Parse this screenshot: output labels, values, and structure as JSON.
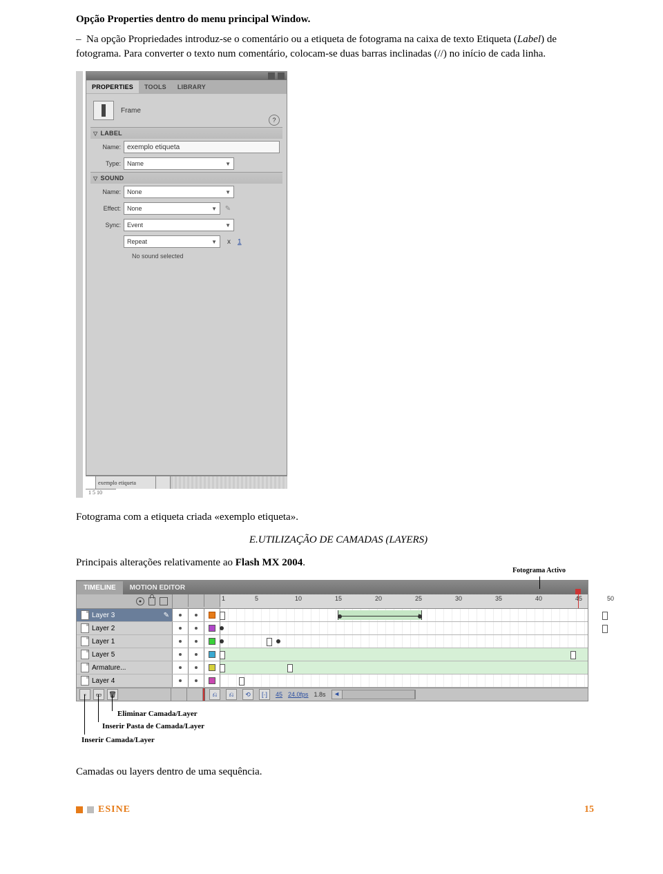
{
  "title": "Opção Properties dentro do menu principal Window.",
  "para1_a": "Na opção Propriedades introduz-se o comentário ou a etiqueta de fotograma na caixa de texto Etiqueta (",
  "para1_it": "Label",
  "para1_b": ") de fotograma. Para converter o texto num comentário, colocam-se duas barras inclinadas (//) no início de cada linha.",
  "props": {
    "tabs": {
      "properties": "PROPERTIES",
      "tools": "TOOLS",
      "library": "LIBRARY"
    },
    "frame": "Frame",
    "label_section": "LABEL",
    "name_label": "Name:",
    "name_value": "exemplo etiqueta",
    "type_label": "Type:",
    "type_value": "Name",
    "sound_section": "SOUND",
    "s_name_label": "Name:",
    "s_name_value": "None",
    "effect_label": "Effect:",
    "effect_value": "None",
    "sync_label": "Sync:",
    "sync_value": "Event",
    "repeat": "Repeat",
    "x": "x",
    "one": "1",
    "nosound": "No sound selected",
    "bottom_label": "exemplo etiqueta",
    "bottom_nums": "1    5    10"
  },
  "caption1": "Fotograma com a etiqueta criada «exemplo etiqueta».",
  "section_E": "E.UTILIZAÇÃO DE CAMADAS (LAYERS)",
  "para2_a": "Principais alterações relativamente ao ",
  "para2_b": "Flash MX 2004",
  "para2_c": ".",
  "timeline": {
    "fot_activo": "Fotograma Activo",
    "tabs": {
      "timeline": "TIMELINE",
      "motion": "MOTION EDITOR"
    },
    "nums": [
      "1",
      "5",
      "10",
      "15",
      "20",
      "25",
      "30",
      "35",
      "40",
      "45",
      "50"
    ],
    "layers": [
      "Layer 3",
      "Layer 2",
      "Layer 1",
      "Layer 5",
      "Armature...",
      "Layer 4"
    ],
    "frame": "45",
    "fps": "24.0fps",
    "time": "1.8s"
  },
  "labels": {
    "elim": "Eliminar Camada/Layer",
    "pasta": "Inserir Pasta de Camada/Layer",
    "inserir": "Inserir Camada/Layer"
  },
  "caption2": "Camadas ou layers dentro de uma sequência.",
  "footer_brand": "ESINE",
  "page_number": "15"
}
